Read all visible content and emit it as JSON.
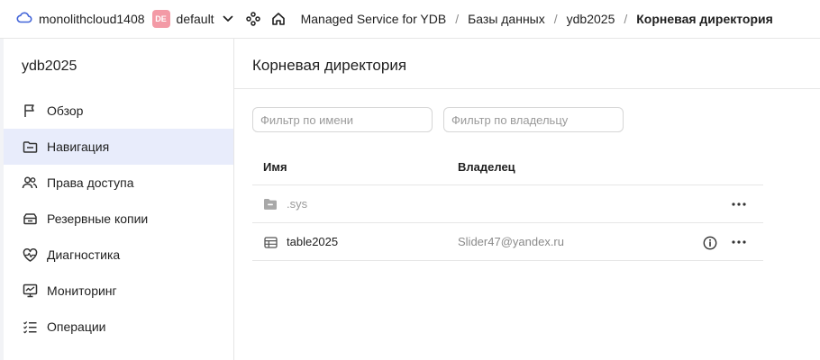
{
  "header": {
    "cloud_name": "monolithcloud1408",
    "folder_badge": "DE",
    "folder_name": "default",
    "breadcrumbs": [
      {
        "label": "Managed Service for YDB"
      },
      {
        "label": "Базы данных"
      },
      {
        "label": "ydb2025"
      },
      {
        "label": "Корневая директория"
      }
    ],
    "breadcrumb_separator": "/"
  },
  "sidebar": {
    "title": "ydb2025",
    "items": [
      {
        "label": "Обзор",
        "icon": "flag-icon"
      },
      {
        "label": "Навигация",
        "icon": "folder-icon",
        "active": true
      },
      {
        "label": "Права доступа",
        "icon": "users-icon"
      },
      {
        "label": "Резервные копии",
        "icon": "backup-icon"
      },
      {
        "label": "Диагностика",
        "icon": "heart-pulse-icon"
      },
      {
        "label": "Мониторинг",
        "icon": "monitor-icon"
      },
      {
        "label": "Операции",
        "icon": "list-check-icon"
      }
    ]
  },
  "main": {
    "title": "Корневая директория",
    "filters": {
      "name_placeholder": "Фильтр по имени",
      "owner_placeholder": "Фильтр по владельцу"
    },
    "table": {
      "columns": [
        "Имя",
        "Владелец"
      ],
      "rows": [
        {
          "name": ".sys",
          "owner": "",
          "type": "folder-icon"
        },
        {
          "name": "table2025",
          "owner": "Slider47@yandex.ru",
          "type": "table-icon"
        }
      ]
    }
  },
  "colors": {
    "accent": "#4163d8",
    "active_bg": "#e8ecfb",
    "badge": "#f39aa6"
  }
}
